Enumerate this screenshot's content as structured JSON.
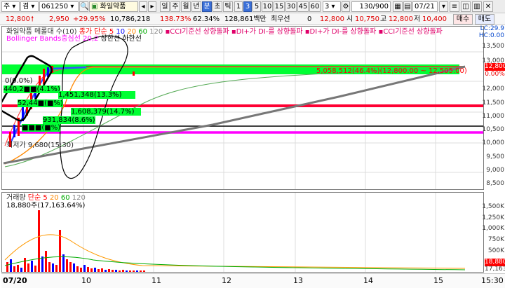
{
  "toolbar": {
    "type_label": "주",
    "mode_label": "겸",
    "code": "061250",
    "name": "화일약품",
    "period_buttons": [
      "일",
      "주",
      "월",
      "년",
      "분",
      "초",
      "틱"
    ],
    "interval_buttons": [
      "1",
      "3",
      "5",
      "10",
      "15",
      "30",
      "45",
      "60"
    ],
    "interval_value": "3",
    "count": "130/900",
    "date": "07/21"
  },
  "quote": {
    "price": "12,800",
    "change": "2,950",
    "change_rate": "+29.95%",
    "volume": "10,786,218",
    "volume_ratio": "138.73%",
    "turnover": "62.34%",
    "amount": "128,861백만",
    "quote_label": "최우선",
    "q0": "0",
    "q1": "12,800",
    "open_label": "시",
    "open": "10,750",
    "high_label": "고",
    "high": "12,800",
    "low_label": "저",
    "low": "10,400",
    "buy_label": "매수",
    "sell_label": "매도"
  },
  "legend": {
    "title": "화일약품 메롤대 수(10)",
    "ma_label": "종가 단순 5",
    "ma_periods": [
      "10",
      "20",
      "60",
      "120"
    ],
    "cci": "CCI기준선 상향돌파",
    "di1": "DI+가 DI-를 상향돌파",
    "di2": "DI+가 DI-를 상향돌파",
    "cci2": "CCI기준선 상향돌파",
    "bollinger": "Bollinger Bands중심선 20,2",
    "upper": "상한선",
    "lower": "하한선",
    "lc": "LC:29.9",
    "hc": "HC:0.00"
  },
  "price_axis": {
    "ticks": [
      "13,500",
      "13,000",
      "12,500",
      "12,000",
      "11,500",
      "11,000",
      "10,500",
      "10,000",
      "9,500",
      "9,000",
      "8,500"
    ],
    "tag_price": "12,800",
    "tag_pct": "0.00%"
  },
  "annotations": {
    "a1": "0(0.0%)",
    "a2": "440,2■■(4.1%)",
    "a3": "1,451,348(13.3%)",
    "a4": "52,44■(■%)",
    "a5": "1,608,379(14.7%)",
    "a6": "931,834(8.6%)",
    "a7": "■■■(■%)",
    "a8": "최저가 9,680(15:30)",
    "a9": "5,058,512(46.4%)(12,800.00 ~ 12,505.00)"
  },
  "volume": {
    "title": "거래량",
    "ma_label": "단순 5",
    "ma_periods": [
      "20",
      "60",
      "120"
    ],
    "current": "18,880주(17,163.64%)",
    "ticks": [
      "1,500K",
      "1,250K",
      "1,000K",
      "750K",
      "500K",
      "250K"
    ],
    "tag1": "18,880",
    "tag2": "17,163"
  },
  "xaxis": {
    "labels": [
      "07/20",
      "10",
      "11",
      "12",
      "13",
      "14",
      "15",
      "15:30"
    ]
  },
  "colors": {
    "up": "#ff0000",
    "down": "#0000ff",
    "highlight": "#00ff33",
    "magenta": "#ff00ff"
  }
}
